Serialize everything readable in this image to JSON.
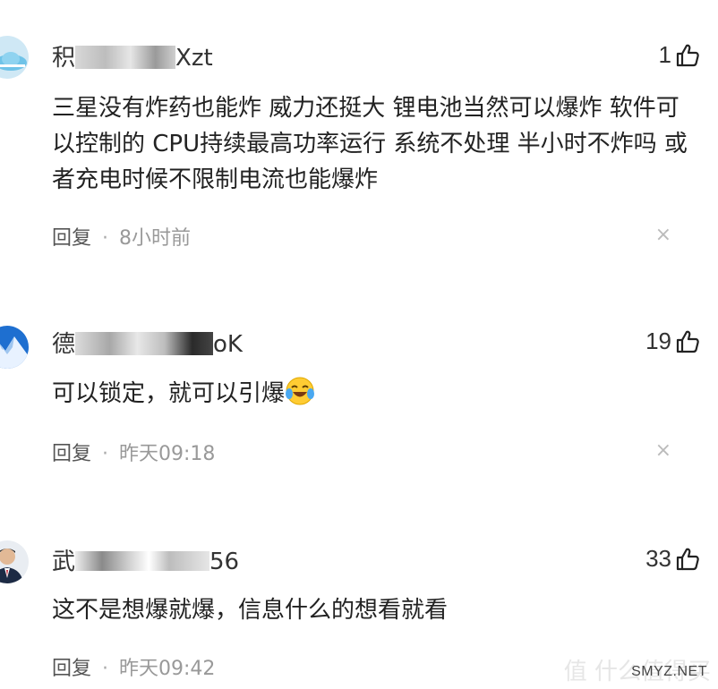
{
  "comments": [
    {
      "username_prefix": "积",
      "username_suffix": "Xzt",
      "likes": "1",
      "content": "三星没有炸药也能炸 威力还挺大 锂电池当然可以爆炸 软件可以控制的 CPU持续最高功率运行 系统不处理 半小时不炸吗 或者充电时候不限制电流也能爆炸",
      "reply_label": "回复",
      "time": "8小时前",
      "close_icon": "×"
    },
    {
      "username_prefix": "德",
      "username_suffix": "oK",
      "likes": "19",
      "content": "可以锁定，就可以引爆",
      "reply_label": "回复",
      "time": "昨天09:18",
      "close_icon": "×"
    },
    {
      "username_prefix": "武",
      "username_suffix": "56",
      "likes": "33",
      "content": "这不是想爆就爆，信息什么的想看就看",
      "reply_label": "回复",
      "time": "昨天09:42"
    }
  ],
  "watermark": {
    "text": "值 什么值得买",
    "site": "SMYZ.NET"
  },
  "colors": {
    "text": "#222222",
    "meta": "#999999",
    "close": "#bbbbbb"
  }
}
